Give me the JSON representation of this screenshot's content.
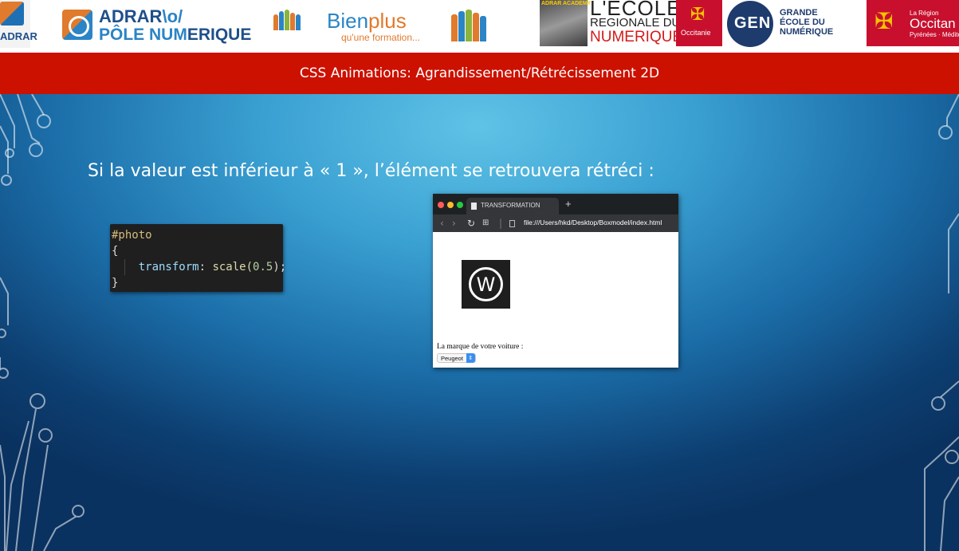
{
  "logos": {
    "adrar_small": "ADRAR",
    "adrar_main_line1_a": "ADRAR",
    "adrar_main_line1_b": "\\o/",
    "adrar_main_line2_a": "PÔLE NUM",
    "adrar_main_line2_b": "ERIQUE",
    "bienplus_a": "Bien",
    "bienplus_b": "plus",
    "bienplus_tagline": "qu'une formation...",
    "ecole_badge": "ADRAR ACADEMY",
    "ecole_line1": "L'ECOLE",
    "ecole_line2": "REGIONALE DU",
    "ecole_line3": "NUMERIQUE",
    "occitanie_mini": "Occitanie",
    "gen_mark": "GEN",
    "gen_text_1": "GRANDE",
    "gen_text_2": "ÉCOLE DU",
    "gen_text_3": "NUMÉRIQUE",
    "occitanie_region": "La Région",
    "occitanie_name": "Occitan",
    "occitanie_sub": "Pyrénées · Méditerr"
  },
  "title": "CSS Animations: Agrandissement/Rétrécissement 2D",
  "heading": "Si la valeur est inférieur à « 1 », l’élément se retrouvera rétréci :",
  "code": {
    "selector": "#photo",
    "open_brace": "{",
    "property": "transform",
    "colon": ": ",
    "function": "scale(",
    "number": "0.5",
    "close_call": ");",
    "close_brace": "}"
  },
  "browser": {
    "tab_title": "TRANSFORMATION",
    "new_tab": "+",
    "url": "file:///Users/hkd/Desktop/Boxmodel/index.html",
    "logo_letter": "W",
    "car_label": "La marque de votre voiture :",
    "car_selected": "Peugeot"
  },
  "colors": {
    "title_bar": "#cc1100",
    "slide_light": "#5fc3e6",
    "slide_dark": "#0a3260"
  }
}
